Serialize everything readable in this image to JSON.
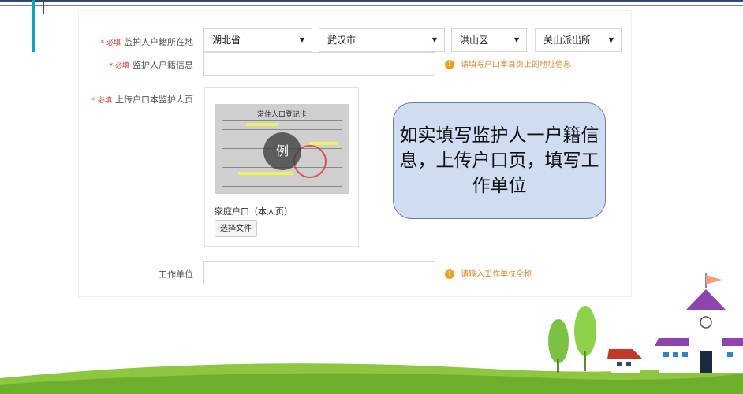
{
  "form": {
    "household_location": {
      "required_mark": "* 必填",
      "label": "监护人户籍所在地",
      "province": "湖北省",
      "city": "武汉市",
      "district": "洪山区",
      "police_station": "关山派出所"
    },
    "household_info": {
      "required_mark": "* 必填",
      "label": "监护人户籍信息",
      "value": "",
      "hint": "请填写户口本首页上的地址信息"
    },
    "upload": {
      "required_mark": "* 必填",
      "label": "上传户口本监护人页",
      "sample_title": "常住人口登记卡",
      "example_badge": "例",
      "caption": "家庭户口（本人页）",
      "button": "选择文件"
    },
    "work_unit": {
      "label": "工作单位",
      "value": "",
      "hint": "请输入工作单位全称"
    }
  },
  "callout": {
    "text": "如实填写监护人一户籍信息，上传户口页，填写工作单位"
  },
  "colors": {
    "required": "#d63b3b",
    "hint": "#e0862a",
    "callout_bg": "#cfdcf1",
    "callout_border": "#6b7fa6",
    "top_rule": "#2f4a6b",
    "accent": "#0aa6c9"
  }
}
